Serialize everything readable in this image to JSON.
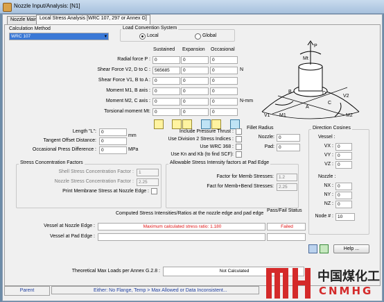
{
  "window": {
    "title": "Nozzle Input/Analysis:  [N1]"
  },
  "tabs": [
    {
      "label": "Nozzle Main"
    },
    {
      "label": "Local Stress Analysis [WRC 107, 297 or Annex G]"
    }
  ],
  "calc_method": {
    "group": "Calculation Method",
    "value": "WRC 107"
  },
  "load_conv": {
    "group": "Load Convention System",
    "options": [
      "Local",
      "Global"
    ],
    "selected": "Local"
  },
  "loads": {
    "columns": [
      "Sustained",
      "Expansion",
      "Occasional"
    ],
    "rows": [
      {
        "label": "Radial force P :",
        "values": [
          "0",
          "0",
          "0"
        ]
      },
      {
        "label": "Shear Force V2, D to C :",
        "values": [
          "565685",
          "0",
          "0"
        ]
      },
      {
        "label": "Shear Force V1, B to A :",
        "values": [
          "0",
          "0",
          "0"
        ]
      },
      {
        "label": "Moment M1, B axis :",
        "values": [
          "0",
          "0",
          "0"
        ]
      },
      {
        "label": "Moment M2, C axis :",
        "values": [
          "0",
          "0",
          "0"
        ]
      },
      {
        "label": "Torsional moment Mt:",
        "values": [
          "0",
          "0",
          "0"
        ]
      }
    ],
    "unit_force": "N",
    "unit_moment": "N-mm"
  },
  "diagram": {
    "labels": [
      "P",
      "Mt",
      "B",
      "A",
      "C",
      "D",
      "V1",
      "M1",
      "V2",
      "M2"
    ]
  },
  "geometry": {
    "length_label": "Length \"L\":",
    "length_value": "0",
    "length_unit": "mm",
    "tangent_label": "Tangent Offset Distance:",
    "tangent_value": "0",
    "occ_label": "Occasional Press Difference :",
    "occ_value": "0",
    "occ_unit": "MPa"
  },
  "options": [
    {
      "label": "Include Pressure Thrust :",
      "checked": false
    },
    {
      "label": "Use Division 2 Stress Indices :",
      "checked": false
    },
    {
      "label": "Use WRC 368 :",
      "checked": false
    },
    {
      "label": "Use Kn and Kb (to find SCF):",
      "checked": false
    }
  ],
  "fillet": {
    "title": "Fillet Radius",
    "nozzle_label": "Nozzle:",
    "nozzle_value": "0",
    "pad_label": "Pad:",
    "pad_value": "0"
  },
  "direction": {
    "title": "Direction Cosines",
    "vessel_label": "Vessel :",
    "vessel": [
      {
        "label": "VX :",
        "value": "0"
      },
      {
        "label": "VY :",
        "value": "0"
      },
      {
        "label": "VZ :",
        "value": "0"
      }
    ],
    "nozzle_label": "Nozzle :",
    "nozzle": [
      {
        "label": "NX :",
        "value": "0"
      },
      {
        "label": "NY :",
        "value": "0"
      },
      {
        "label": "NZ :",
        "value": "0"
      }
    ],
    "node_label": "Node # :",
    "node_value": "10"
  },
  "scf": {
    "title": "Stress Concentration Factors",
    "shell_label": "Shell Stress Concentration Factor :",
    "shell_value": "1",
    "nozzle_label": "Nozzle Stress Concentration Factor :",
    "nozzle_value": "2.25",
    "print_label": "Print Membrane Stress at Nozzle Edge :"
  },
  "allowable": {
    "title": "Allowable Stress Intensity factors at Pad Edge",
    "memb_label": "Factor for Memb Stresses:",
    "memb_value": "1.2",
    "fact_label": "Fact for Memb+Bend Stresses:",
    "fact_value": "2.25"
  },
  "results": {
    "header": "Computed Stress Intensities/Ratios at the nozzle edge and pad edge",
    "pass_header": "Pass/Fail Status",
    "rows": [
      {
        "label": "Vessel at Nozzle Edge :",
        "value": "Maximum calculated stress ratio: 1.180",
        "status": "Failed"
      },
      {
        "label": "Vessel at Pad Edge :",
        "value": "",
        "status": ""
      }
    ]
  },
  "theoretical": {
    "label": "Theoretical Max Loads per Annex G.2.8 :",
    "value": "Not Calculated"
  },
  "help_button": "Help ...",
  "status": {
    "parent": "Parent",
    "message": "Either: No Flange, Temp > Max Allowed or Data Inconsistent..."
  },
  "watermark": {
    "cn": "中国煤化工",
    "en": "CNMHG"
  },
  "colors": {
    "fail": "#e01010",
    "watermark": "#d42a2a",
    "titlebar": "#b8cfe7"
  }
}
